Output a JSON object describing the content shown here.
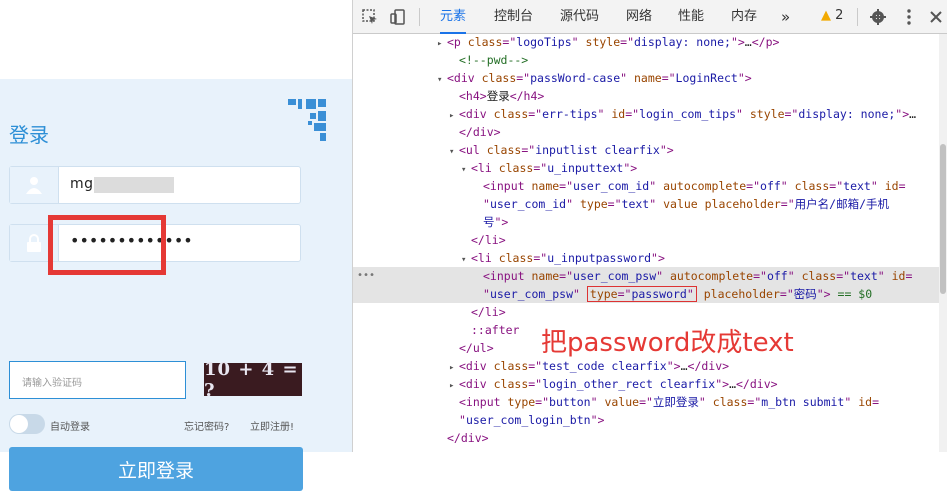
{
  "login": {
    "title": "登录",
    "username_value": "mg    9",
    "password_value": "•••••••••••••",
    "captcha_placeholder": "请输入验证码",
    "captcha_image_text": "10 + 4 = ?",
    "auto_login_label": "自动登录",
    "forgot_label": "忘记密码?",
    "register_label": "立即注册!",
    "submit_label": "立即登录",
    "icons": {
      "user": "user-icon",
      "lock": "lock-icon",
      "qr": "qr-code-icon"
    },
    "colors": {
      "accent": "#2d8fd6",
      "button": "#4ea3e0",
      "highlight": "#e53935"
    }
  },
  "devtools": {
    "tabs": [
      "元素",
      "控制台",
      "源代码",
      "网络",
      "性能",
      "内存"
    ],
    "more": "»",
    "warnings": "2",
    "annotation": "把password改成text",
    "lines": [
      {
        "indent": 0,
        "arrow": "▸",
        "parts": [
          [
            "tag",
            "<p "
          ],
          [
            "an",
            "class"
          ],
          [
            "tag",
            "=\""
          ],
          [
            "av",
            "logoTips"
          ],
          [
            "tag",
            "\" "
          ],
          [
            "an",
            "style"
          ],
          [
            "tag",
            "=\""
          ],
          [
            "av",
            "display: none;"
          ],
          [
            "tag",
            "\">"
          ],
          [
            "tx",
            "…"
          ],
          [
            "tag",
            "</p>"
          ]
        ]
      },
      {
        "indent": 1,
        "arrow": "",
        "parts": [
          [
            "cm",
            "<!--pwd-->"
          ]
        ]
      },
      {
        "indent": 0,
        "arrow": "▾",
        "parts": [
          [
            "tag",
            "<div "
          ],
          [
            "an",
            "class"
          ],
          [
            "tag",
            "=\""
          ],
          [
            "av",
            "passWord-case"
          ],
          [
            "tag",
            "\" "
          ],
          [
            "an",
            "name"
          ],
          [
            "tag",
            "=\""
          ],
          [
            "av",
            "LoginRect"
          ],
          [
            "tag",
            "\">"
          ]
        ]
      },
      {
        "indent": 1,
        "arrow": "",
        "parts": [
          [
            "tag",
            "<h4>"
          ],
          [
            "tx",
            "登录"
          ],
          [
            "tag",
            "</h4>"
          ]
        ]
      },
      {
        "indent": 1,
        "arrow": "▸",
        "parts": [
          [
            "tag",
            "<div "
          ],
          [
            "an",
            "class"
          ],
          [
            "tag",
            "=\""
          ],
          [
            "av",
            "err-tips"
          ],
          [
            "tag",
            "\" "
          ],
          [
            "an",
            "id"
          ],
          [
            "tag",
            "=\""
          ],
          [
            "av",
            "login_com_tips"
          ],
          [
            "tag",
            "\" "
          ],
          [
            "an",
            "style"
          ],
          [
            "tag",
            "=\""
          ],
          [
            "av",
            "display: none;"
          ],
          [
            "tag",
            "\">"
          ],
          [
            "tx",
            "…"
          ]
        ]
      },
      {
        "indent": 1,
        "arrow": "",
        "parts": [
          [
            "tag",
            "</div>"
          ]
        ]
      },
      {
        "indent": 1,
        "arrow": "▾",
        "parts": [
          [
            "tag",
            "<ul "
          ],
          [
            "an",
            "class"
          ],
          [
            "tag",
            "=\""
          ],
          [
            "av",
            "inputlist clearfix"
          ],
          [
            "tag",
            "\">"
          ]
        ]
      },
      {
        "indent": 2,
        "arrow": "▾",
        "parts": [
          [
            "tag",
            "<li "
          ],
          [
            "an",
            "class"
          ],
          [
            "tag",
            "=\""
          ],
          [
            "av",
            "u_inputtext"
          ],
          [
            "tag",
            "\">"
          ]
        ]
      },
      {
        "indent": 3,
        "arrow": "",
        "parts": [
          [
            "tag",
            "<input "
          ],
          [
            "an",
            "name"
          ],
          [
            "tag",
            "=\""
          ],
          [
            "av",
            "user_com_id"
          ],
          [
            "tag",
            "\" "
          ],
          [
            "an",
            "autocomplete"
          ],
          [
            "tag",
            "=\""
          ],
          [
            "av",
            "off"
          ],
          [
            "tag",
            "\" "
          ],
          [
            "an",
            "class"
          ],
          [
            "tag",
            "=\""
          ],
          [
            "av",
            "text"
          ],
          [
            "tag",
            "\" "
          ],
          [
            "an",
            "id"
          ],
          [
            "tag",
            "="
          ]
        ]
      },
      {
        "indent": 3,
        "arrow": "",
        "parts": [
          [
            "tag",
            "\""
          ],
          [
            "av",
            "user_com_id"
          ],
          [
            "tag",
            "\" "
          ],
          [
            "an",
            "type"
          ],
          [
            "tag",
            "=\""
          ],
          [
            "av",
            "text"
          ],
          [
            "tag",
            "\" "
          ],
          [
            "an",
            "value placeholder"
          ],
          [
            "tag",
            "=\""
          ],
          [
            "av",
            "用户名/邮箱/手机"
          ]
        ]
      },
      {
        "indent": 3,
        "arrow": "",
        "parts": [
          [
            "av",
            "号"
          ],
          [
            "tag",
            "\">"
          ]
        ]
      },
      {
        "indent": 2,
        "arrow": "",
        "parts": [
          [
            "tag",
            "</li>"
          ]
        ]
      },
      {
        "indent": 2,
        "arrow": "▾",
        "parts": [
          [
            "tag",
            "<li "
          ],
          [
            "an",
            "class"
          ],
          [
            "tag",
            "=\""
          ],
          [
            "av",
            "u_inputpassword"
          ],
          [
            "tag",
            "\">"
          ]
        ]
      },
      {
        "indent": 3,
        "arrow": "",
        "sel": true,
        "parts": [
          [
            "tag",
            "<input "
          ],
          [
            "an",
            "name"
          ],
          [
            "tag",
            "=\""
          ],
          [
            "av",
            "user_com_psw"
          ],
          [
            "tag",
            "\" "
          ],
          [
            "an",
            "autocomplete"
          ],
          [
            "tag",
            "=\""
          ],
          [
            "av",
            "off"
          ],
          [
            "tag",
            "\" "
          ],
          [
            "an",
            "class"
          ],
          [
            "tag",
            "=\""
          ],
          [
            "av",
            "text"
          ],
          [
            "tag",
            "\" "
          ],
          [
            "an",
            "id"
          ],
          [
            "tag",
            "="
          ]
        ]
      },
      {
        "indent": 3,
        "arrow": "",
        "sel": true,
        "parts": [
          [
            "tag",
            "\""
          ],
          [
            "av",
            "user_com_psw"
          ],
          [
            "tag",
            "\" "
          ],
          [
            "box",
            "type=\"password\""
          ],
          [
            "tag",
            " "
          ],
          [
            "an",
            "placeholder"
          ],
          [
            "tag",
            "=\""
          ],
          [
            "av",
            "密码"
          ],
          [
            "tag",
            "\"> "
          ],
          [
            "cm",
            "== $0"
          ]
        ]
      },
      {
        "indent": 2,
        "arrow": "",
        "parts": [
          [
            "tag",
            "</li>"
          ]
        ]
      },
      {
        "indent": 2,
        "arrow": "",
        "parts": [
          [
            "pseudo",
            "::after"
          ]
        ]
      },
      {
        "indent": 1,
        "arrow": "",
        "parts": [
          [
            "tag",
            "</ul>"
          ]
        ]
      },
      {
        "indent": 1,
        "arrow": "▸",
        "parts": [
          [
            "tag",
            "<div "
          ],
          [
            "an",
            "class"
          ],
          [
            "tag",
            "=\""
          ],
          [
            "av",
            "test_code clearfix"
          ],
          [
            "tag",
            "\">"
          ],
          [
            "tx",
            "…"
          ],
          [
            "tag",
            "</div>"
          ]
        ]
      },
      {
        "indent": 1,
        "arrow": "▸",
        "parts": [
          [
            "tag",
            "<div "
          ],
          [
            "an",
            "class"
          ],
          [
            "tag",
            "=\""
          ],
          [
            "av",
            "login_other_rect clearfix"
          ],
          [
            "tag",
            "\">"
          ],
          [
            "tx",
            "…"
          ],
          [
            "tag",
            "</div>"
          ]
        ]
      },
      {
        "indent": 1,
        "arrow": "",
        "parts": [
          [
            "tag",
            "<input "
          ],
          [
            "an",
            "type"
          ],
          [
            "tag",
            "=\""
          ],
          [
            "av",
            "button"
          ],
          [
            "tag",
            "\" "
          ],
          [
            "an",
            "value"
          ],
          [
            "tag",
            "=\""
          ],
          [
            "av",
            "立即登录"
          ],
          [
            "tag",
            "\" "
          ],
          [
            "an",
            "class"
          ],
          [
            "tag",
            "=\""
          ],
          [
            "av",
            "m_btn submit"
          ],
          [
            "tag",
            "\" "
          ],
          [
            "an",
            "id"
          ],
          [
            "tag",
            "="
          ]
        ]
      },
      {
        "indent": 1,
        "arrow": "",
        "parts": [
          [
            "tag",
            "\""
          ],
          [
            "av",
            "user_com_login_btn"
          ],
          [
            "tag",
            "\">"
          ]
        ]
      },
      {
        "indent": 0,
        "arrow": "",
        "parts": [
          [
            "tag",
            "</div>"
          ]
        ]
      }
    ]
  }
}
